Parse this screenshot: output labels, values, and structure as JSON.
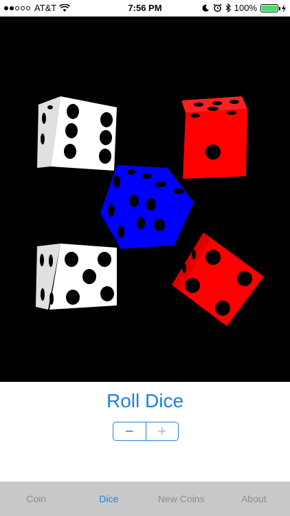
{
  "status_bar": {
    "signal_filled": 2,
    "signal_total": 5,
    "carrier": "AT&T",
    "time": "7:56 PM",
    "battery_text": "100%",
    "battery_level": 1.0
  },
  "dice": [
    {
      "color": "#ffffff",
      "face_value": 6
    },
    {
      "color": "#ff0000",
      "face_value": 1
    },
    {
      "color": "#0000ff",
      "face_value": 6
    },
    {
      "color": "#ffffff",
      "face_value": 5
    },
    {
      "color": "#ff0000",
      "face_value": 4
    }
  ],
  "controls": {
    "roll_label": "Roll Dice",
    "minus_label": "−",
    "plus_label": "+"
  },
  "tabs": [
    {
      "label": "Coin",
      "active": false
    },
    {
      "label": "Dice",
      "active": true
    },
    {
      "label": "New Coins",
      "active": false
    },
    {
      "label": "About",
      "active": false
    }
  ],
  "colors": {
    "accent": "#1e7fe0",
    "tab_bar": "#c8c8c8",
    "dice_background": "#000000"
  }
}
